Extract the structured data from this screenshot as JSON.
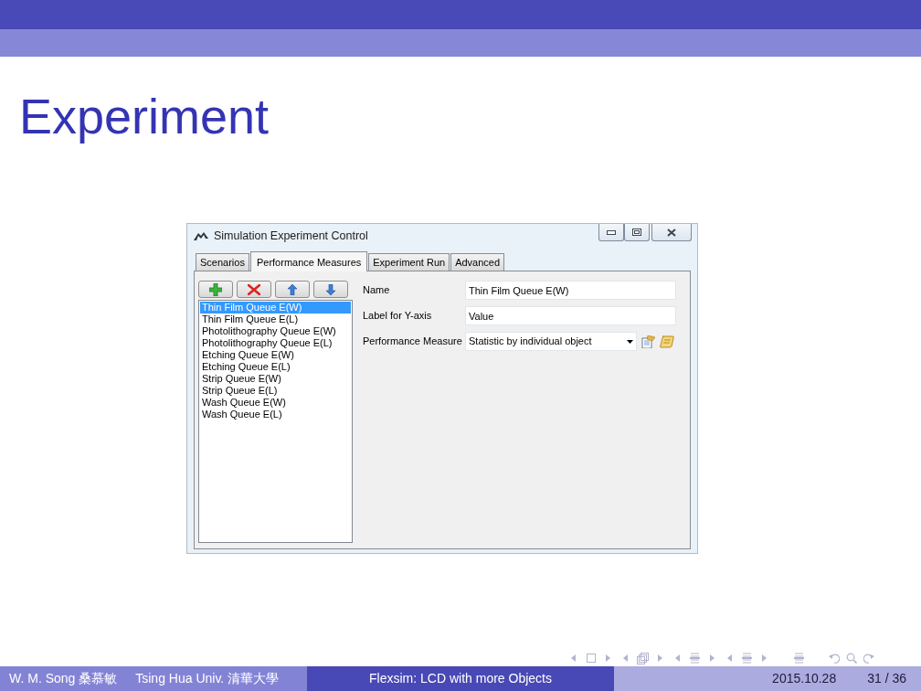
{
  "slide": {
    "title": "Experiment"
  },
  "window": {
    "title": "Simulation Experiment Control",
    "tabs": [
      {
        "label": "Scenarios",
        "selected": false
      },
      {
        "label": "Performance Measures",
        "selected": true
      },
      {
        "label": "Experiment Run",
        "selected": false
      },
      {
        "label": "Advanced",
        "selected": false
      }
    ],
    "measures": [
      {
        "label": "Thin Film Queue E(W)",
        "selected": true
      },
      {
        "label": "Thin Film Queue E(L)",
        "selected": false
      },
      {
        "label": "Photolithography Queue E(W)",
        "selected": false
      },
      {
        "label": "Photolithography Queue E(L)",
        "selected": false
      },
      {
        "label": "Etching Queue E(W)",
        "selected": false
      },
      {
        "label": "Etching Queue E(L)",
        "selected": false
      },
      {
        "label": "Strip Queue E(W)",
        "selected": false
      },
      {
        "label": "Strip Queue E(L)",
        "selected": false
      },
      {
        "label": "Wash Queue E(W)",
        "selected": false
      },
      {
        "label": "Wash Queue E(L)",
        "selected": false
      }
    ],
    "fields": [
      {
        "label": "Name",
        "kind": "text",
        "value": "Thin Film Queue E(W)"
      },
      {
        "label": "Label for Y-axis",
        "kind": "text",
        "value": "Value"
      },
      {
        "label": "Performance Measure",
        "kind": "select",
        "value": "Statistic by individual object"
      }
    ]
  },
  "footer": {
    "author": "W. M. Song 桑慕敏",
    "institute": "Tsing Hua Univ. 清華大學",
    "talk_title": "Flexsim: LCD with more Objects",
    "date": "2015.10.28",
    "page": "31 / 36"
  }
}
